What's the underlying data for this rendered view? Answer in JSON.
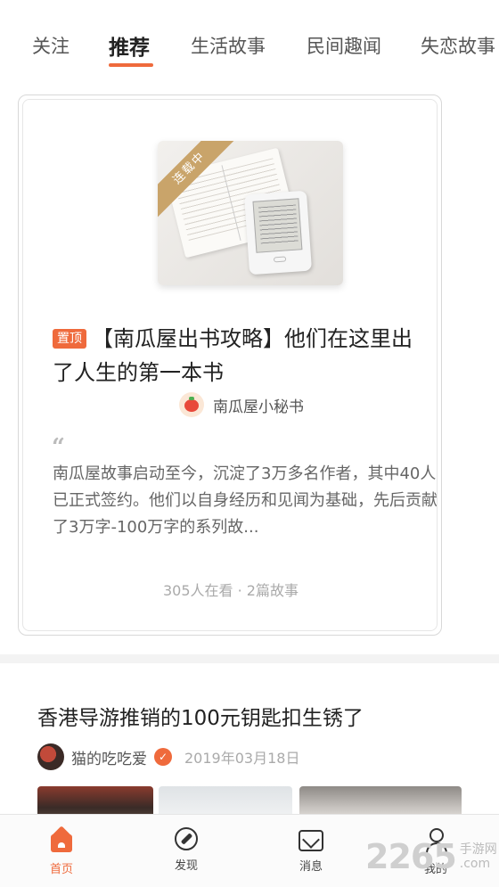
{
  "tabs": [
    {
      "label": "关注"
    },
    {
      "label": "推荐"
    },
    {
      "label": "生活故事"
    },
    {
      "label": "民间趣闻"
    },
    {
      "label": "失恋故事"
    }
  ],
  "active_tab_index": 1,
  "featured": {
    "cover_ribbon": "连载中",
    "pin_badge": "置顶",
    "title": "【南瓜屋出书攻略】他们在这里出了人生的第一本书",
    "author": "南瓜屋小秘书",
    "quote_mark": "“",
    "excerpt": "南瓜屋故事启动至今，沉淀了3万多名作者，其中40人已正式签约。他们以自身经历和见闻为基础，先后贡献了3万字-100万字的系列故...",
    "stats": "305人在看 · 2篇故事"
  },
  "article": {
    "title": "香港导游推销的100元钥匙扣生锈了",
    "author": "猫的吃吃爱",
    "verified_icon": "verified-badge-icon",
    "date": "2019年03月18日"
  },
  "bottom_nav": [
    {
      "label": "首页",
      "icon": "home-icon",
      "active": true
    },
    {
      "label": "发现",
      "icon": "compass-icon",
      "active": false
    },
    {
      "label": "消息",
      "icon": "message-icon",
      "active": false
    },
    {
      "label": "我的",
      "icon": "user-icon",
      "active": false
    }
  ],
  "watermark": {
    "number": "2265",
    "text_line1": "手游网",
    "text_line2": ".com"
  },
  "colors": {
    "accent": "#ef6a3c",
    "ribbon": "#c9a46a"
  }
}
